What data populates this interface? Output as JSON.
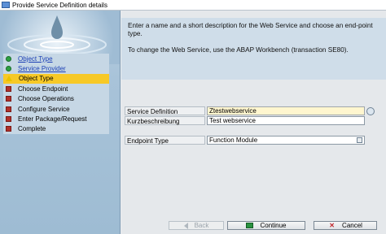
{
  "window": {
    "title": "Provide Service Definition details"
  },
  "wizard": {
    "steps": [
      {
        "label": "Object Type",
        "status": "done",
        "link": true
      },
      {
        "label": "Service Provider",
        "status": "done",
        "link": true
      },
      {
        "label": "Object Type",
        "status": "current",
        "link": false
      },
      {
        "label": "Choose Endpoint",
        "status": "todo",
        "link": false
      },
      {
        "label": "Choose Operations",
        "status": "todo",
        "link": false
      },
      {
        "label": "Configure Service",
        "status": "todo",
        "link": false
      },
      {
        "label": "Enter Package/Request",
        "status": "todo",
        "link": false
      },
      {
        "label": "Complete",
        "status": "todo",
        "link": false
      }
    ]
  },
  "help": {
    "line1": "Enter a name and a short description for the Web Service and choose an end-point type.",
    "line2": "To change the Web Service, use the ABAP Workbench (transaction SE80)."
  },
  "form": {
    "service_definition": {
      "label": "Service Definition",
      "value": "Ztestwebservice"
    },
    "short_description": {
      "label": "Kurzbeschreibung",
      "value": "Test webservice"
    },
    "endpoint_type": {
      "label": "Endpoint Type",
      "value": "Function Module"
    }
  },
  "buttons": {
    "back": "Back",
    "continue": "Continue",
    "cancel": "Cancel"
  },
  "colors": {
    "active_step": "#f7c927",
    "required_field": "#fff6cf",
    "help_bg": "#cfdde9"
  }
}
